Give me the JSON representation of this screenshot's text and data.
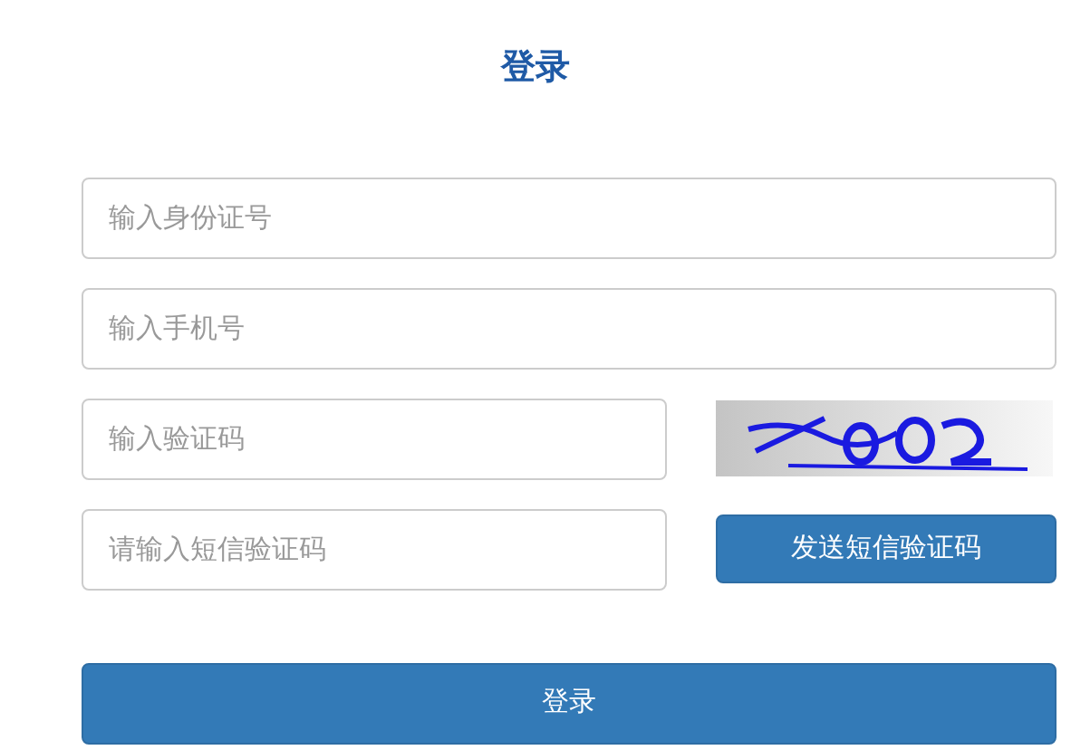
{
  "title": "登录",
  "fields": [
    {
      "placeholder": "输入身份证号"
    },
    {
      "placeholder": "输入手机号"
    }
  ],
  "captcha_row": {
    "field": {
      "placeholder": "输入验证码"
    }
  },
  "sms_row": {
    "field": {
      "placeholder": "请输入短信验证码"
    },
    "button": "发送短信验证码"
  },
  "submit_button": "登录"
}
